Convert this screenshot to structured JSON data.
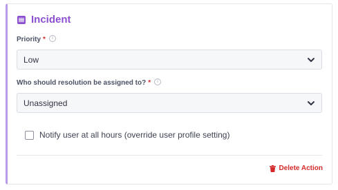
{
  "section": {
    "title": "Incident",
    "icon": "list-icon",
    "accent_color": "#8c4fd1"
  },
  "priority": {
    "label": "Priority",
    "required_mark": "*",
    "selected": "Low"
  },
  "assignee": {
    "label": "Who should resolution be assigned to?",
    "required_mark": "*",
    "selected": "Unassigned"
  },
  "notify": {
    "label": "Notify user at all hours (override user profile setting)",
    "checked": false
  },
  "actions": {
    "delete_label": "Delete Action",
    "delete_color": "#d42a2a"
  }
}
